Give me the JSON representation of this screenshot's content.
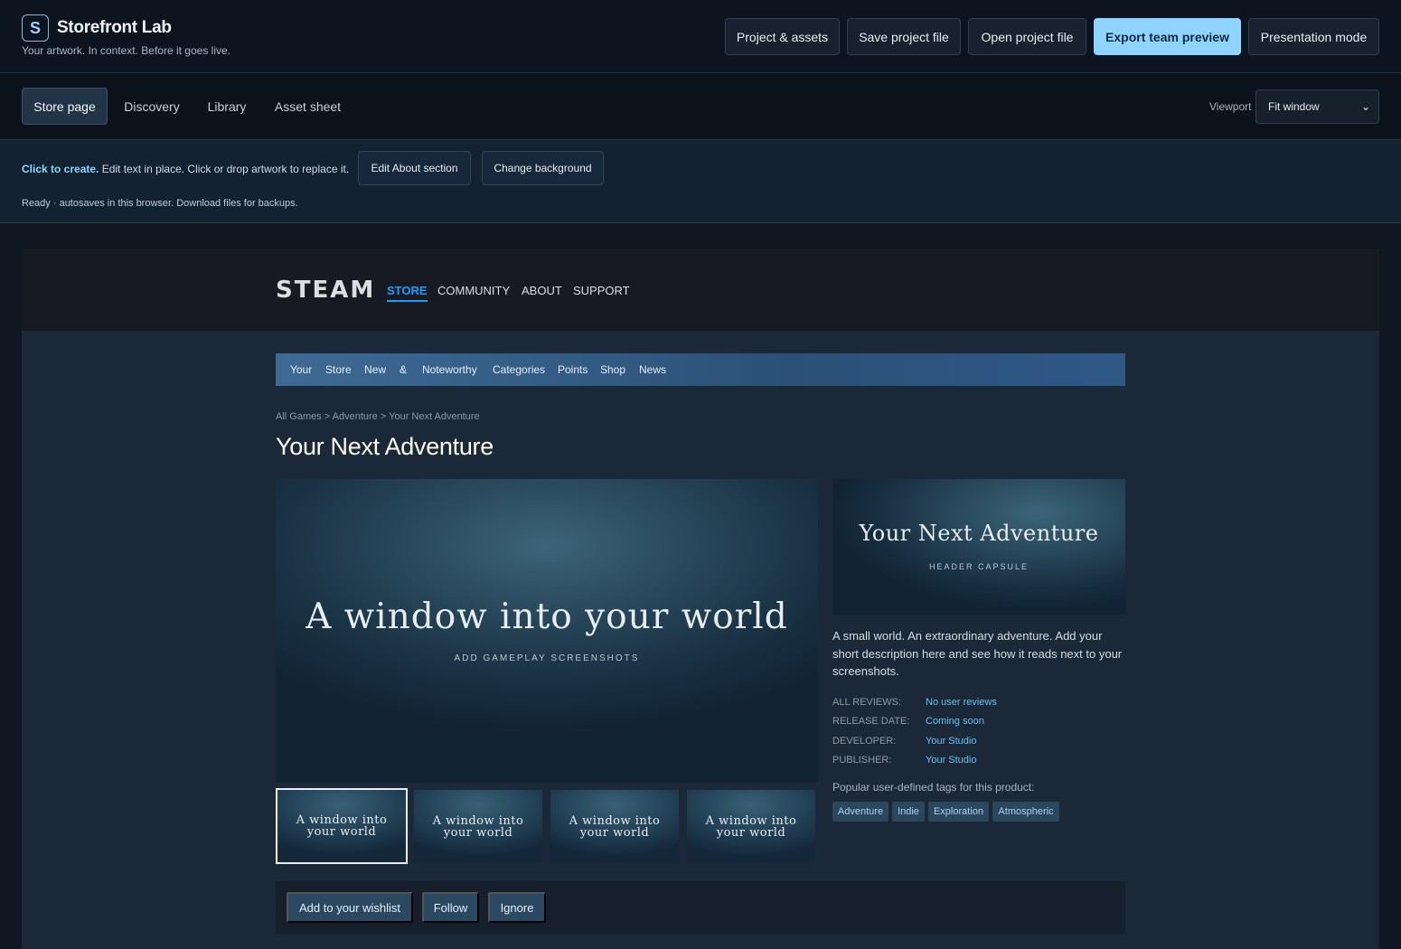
{
  "app": {
    "logo_letter": "S",
    "name": "Storefront Lab",
    "tagline": "Your artwork. In context. Before it goes live."
  },
  "toolbar": {
    "project_assets": "Project & assets",
    "save_project": "Save project file",
    "open_project": "Open project file",
    "export_preview": "Export team preview",
    "presentation_mode": "Presentation mode"
  },
  "tabs": [
    "Store page",
    "Discovery",
    "Library",
    "Asset sheet"
  ],
  "viewport": {
    "label": "Viewport",
    "value": "Fit window"
  },
  "hint": {
    "bold": "Click to create.",
    "text": " Edit text in place. Click or drop artwork to replace it.",
    "edit_about": "Edit About section",
    "change_background": "Change background",
    "status": "Ready · autosaves in this browser. Download files for backups."
  },
  "steam": {
    "logo": "STEAM",
    "nav": [
      "STORE",
      "COMMUNITY",
      "ABOUT",
      "SUPPORT"
    ],
    "store_nav": [
      "Your",
      "Store",
      "New",
      "&",
      "Noteworthy",
      "Categories",
      "Points",
      "Shop",
      "News"
    ]
  },
  "page": {
    "breadcrumb": "All Games > Adventure > Your Next Adventure",
    "title": "Your Next Adventure",
    "hero_title": "A window into your world",
    "hero_sub": "ADD GAMEPLAY SCREENSHOTS",
    "thumb_line1": "A window into",
    "thumb_line2": "your world",
    "capsule_title": "Your Next Adventure",
    "capsule_sub": "HEADER CAPSULE",
    "short_description": "A small world. An extraordinary adventure. Add your short description here and see how it reads next to your screenshots.",
    "meta": [
      {
        "label": "ALL REVIEWS:",
        "value": "No user reviews"
      },
      {
        "label": "RELEASE DATE:",
        "value": "Coming soon"
      },
      {
        "label": "DEVELOPER:",
        "value": "Your Studio"
      },
      {
        "label": "PUBLISHER:",
        "value": "Your Studio"
      }
    ],
    "tags_title": "Popular user-defined tags for this product:",
    "tags": [
      "Adventure",
      "Indie",
      "Exploration",
      "Atmospheric"
    ],
    "actions": [
      "Add to your wishlist",
      "Follow",
      "Ignore"
    ]
  }
}
